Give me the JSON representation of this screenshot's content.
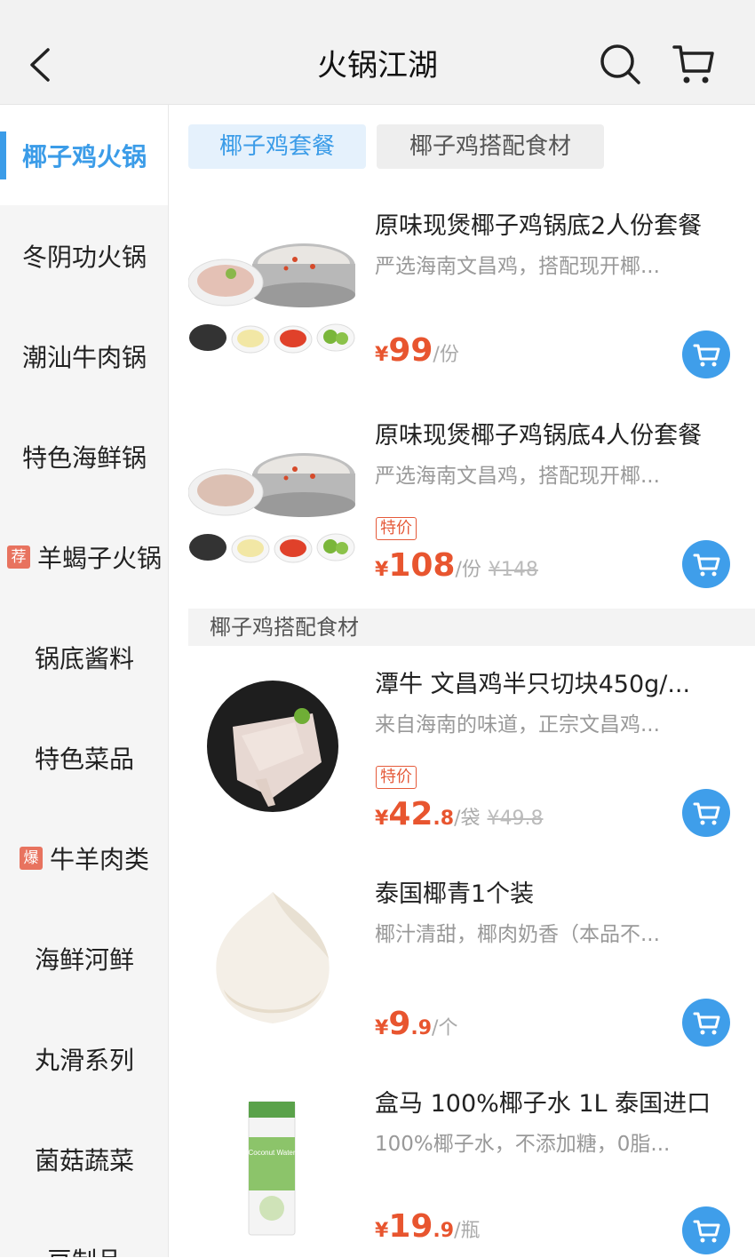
{
  "header": {
    "title": "火锅江湖",
    "back_icon": "chevron-left-icon",
    "search_icon": "search-icon",
    "cart_icon": "cart-icon"
  },
  "sidebar": {
    "items": [
      {
        "label": "椰子鸡火锅",
        "active": true
      },
      {
        "label": "冬阴功火锅"
      },
      {
        "label": "潮汕牛肉锅"
      },
      {
        "label": "特色海鲜锅"
      },
      {
        "label": "羊蝎子火锅",
        "badge": "荐",
        "badge_color": "#e8735f"
      },
      {
        "label": "锅底酱料"
      },
      {
        "label": "特色菜品"
      },
      {
        "label": "牛羊肉类",
        "badge": "爆",
        "badge_color": "#e8735f"
      },
      {
        "label": "海鲜河鲜"
      },
      {
        "label": "丸滑系列"
      },
      {
        "label": "菌菇蔬菜"
      },
      {
        "label": "豆制品"
      }
    ]
  },
  "tabs": [
    {
      "label": "椰子鸡套餐",
      "active": true
    },
    {
      "label": "椰子鸡搭配食材"
    }
  ],
  "section_header": "椰子鸡搭配食材",
  "products": [
    {
      "name": "原味现煲椰子鸡锅底2人份套餐",
      "desc": "严选海南文昌鸡，搭配现开椰...",
      "yen": "¥",
      "price_int": "99",
      "price_dec": "",
      "unit": "/份",
      "tag": "",
      "orig": ""
    },
    {
      "name": "原味现煲椰子鸡锅底4人份套餐",
      "desc": "严选海南文昌鸡，搭配现开椰...",
      "yen": "¥",
      "price_int": "108",
      "price_dec": "",
      "unit": "/份",
      "tag": "特价",
      "orig": "¥148"
    },
    {
      "name": "潭牛 文昌鸡半只切块450g/...",
      "desc": "来自海南的味道，正宗文昌鸡...",
      "yen": "¥",
      "price_int": "42",
      "price_dec": ".8",
      "unit": "/袋",
      "tag": "特价",
      "orig": "¥49.8"
    },
    {
      "name": "泰国椰青1个装",
      "desc": "椰汁清甜，椰肉奶香（本品不...",
      "yen": "¥",
      "price_int": "9",
      "price_dec": ".9",
      "unit": "/个",
      "tag": "",
      "orig": ""
    },
    {
      "name": "盒马 100%椰子水 1L 泰国进口",
      "desc": "100%椰子水，不添加糖，0脂...",
      "yen": "¥",
      "price_int": "19",
      "price_dec": ".9",
      "unit": "/瓶",
      "tag": "",
      "orig": ""
    }
  ],
  "colors": {
    "accent": "#3b9ce8",
    "price": "#e8552f",
    "cart_button": "#3f9eea"
  },
  "coconut_label": "Coconut Water"
}
